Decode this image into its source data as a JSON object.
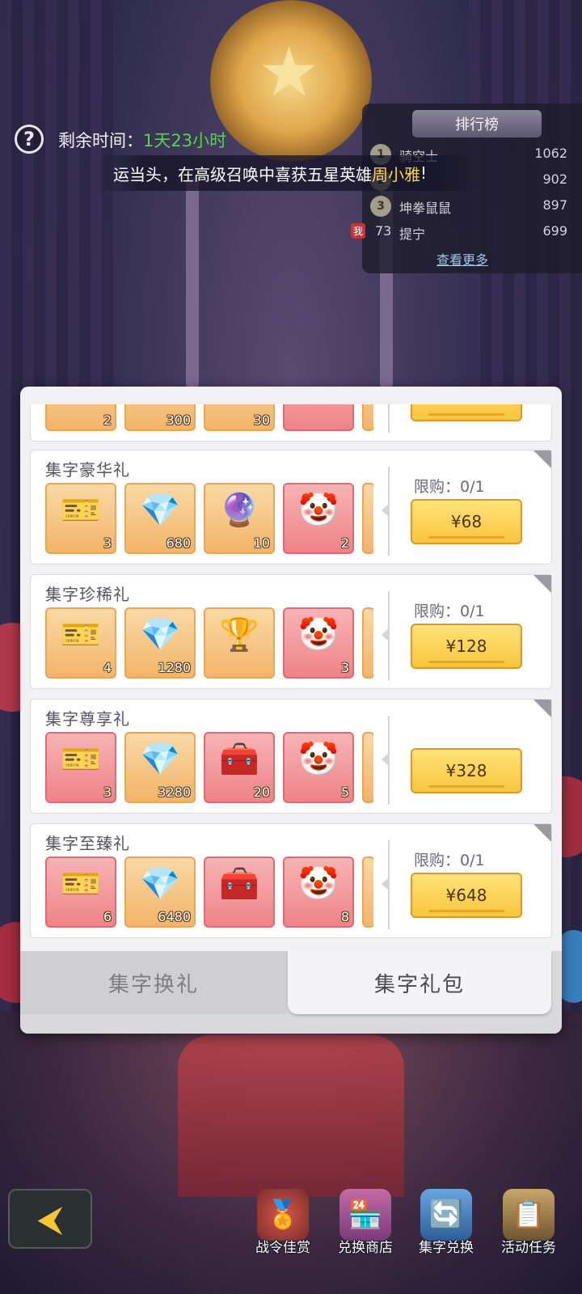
{
  "hud": {
    "timer_label": "剩余时间：",
    "timer_value": "1天23小时"
  },
  "ticker": {
    "text": "运当头，在高级召唤中喜获五星英雄",
    "hero": "周小雅",
    "end": "!"
  },
  "ranking": {
    "title": "排行榜",
    "rows": [
      {
        "rank": "1",
        "name": "骑空士",
        "score": "1062"
      },
      {
        "rank": "2",
        "name": "",
        "score": "902"
      },
      {
        "rank": "3",
        "name": "坤拳鼠鼠",
        "score": "897"
      }
    ],
    "me": {
      "tag": "我",
      "rank": "73",
      "name": "提宁",
      "score": "699"
    },
    "more_label": "查看更多"
  },
  "gifts": [
    {
      "title": "",
      "limit": "",
      "price": "",
      "items": [
        {
          "icon": "ticket-icon",
          "count": "2"
        },
        {
          "icon": "diamond-icon",
          "count": "300"
        },
        {
          "icon": "scroll-icon",
          "count": "30"
        },
        {
          "icon": "chest-icon",
          "count": ""
        }
      ]
    },
    {
      "title": "集字豪华礼",
      "limit": "限购：0/1",
      "price": "¥68",
      "items": [
        {
          "icon": "ticket-icon",
          "count": "3"
        },
        {
          "icon": "diamond-icon",
          "count": "680"
        },
        {
          "icon": "orb-chest-icon",
          "count": "10"
        },
        {
          "icon": "hero-chest-icon",
          "count": "2"
        }
      ]
    },
    {
      "title": "集字珍稀礼",
      "limit": "限购：0/1",
      "price": "¥128",
      "items": [
        {
          "icon": "ticket-icon",
          "count": "4"
        },
        {
          "icon": "diamond-icon",
          "count": "1280"
        },
        {
          "icon": "gem-chest-icon",
          "count": ""
        },
        {
          "icon": "hero-chest-icon",
          "count": "3"
        }
      ]
    },
    {
      "title": "集字尊享礼",
      "limit": "",
      "price": "¥328",
      "items": [
        {
          "icon": "ticket-icon",
          "count": "3"
        },
        {
          "icon": "diamond-icon",
          "count": "3280"
        },
        {
          "icon": "red-chest-icon",
          "count": "20"
        },
        {
          "icon": "hero-chest-icon",
          "count": "5"
        }
      ]
    },
    {
      "title": "集字至臻礼",
      "limit": "限购：0/1",
      "price": "¥648",
      "items": [
        {
          "icon": "ticket-icon",
          "count": "6"
        },
        {
          "icon": "diamond-icon",
          "count": "6480"
        },
        {
          "icon": "red-chest-icon",
          "count": ""
        },
        {
          "icon": "hero-chest-icon",
          "count": "8"
        }
      ]
    }
  ],
  "tabs": {
    "exchange": "集字换礼",
    "pack": "集字礼包"
  },
  "bottom_nav": [
    {
      "icon": "medal-icon",
      "label": "战令佳赏"
    },
    {
      "icon": "shop-icon",
      "label": "兑换商店"
    },
    {
      "icon": "cards-exchange-icon",
      "label": "集字兑换"
    },
    {
      "icon": "task-icon",
      "label": "活动任务"
    }
  ],
  "colors": {
    "accent_gold": "#f9c53e",
    "timer_green": "#5ad24c",
    "hero_highlight": "#ffd34d"
  }
}
